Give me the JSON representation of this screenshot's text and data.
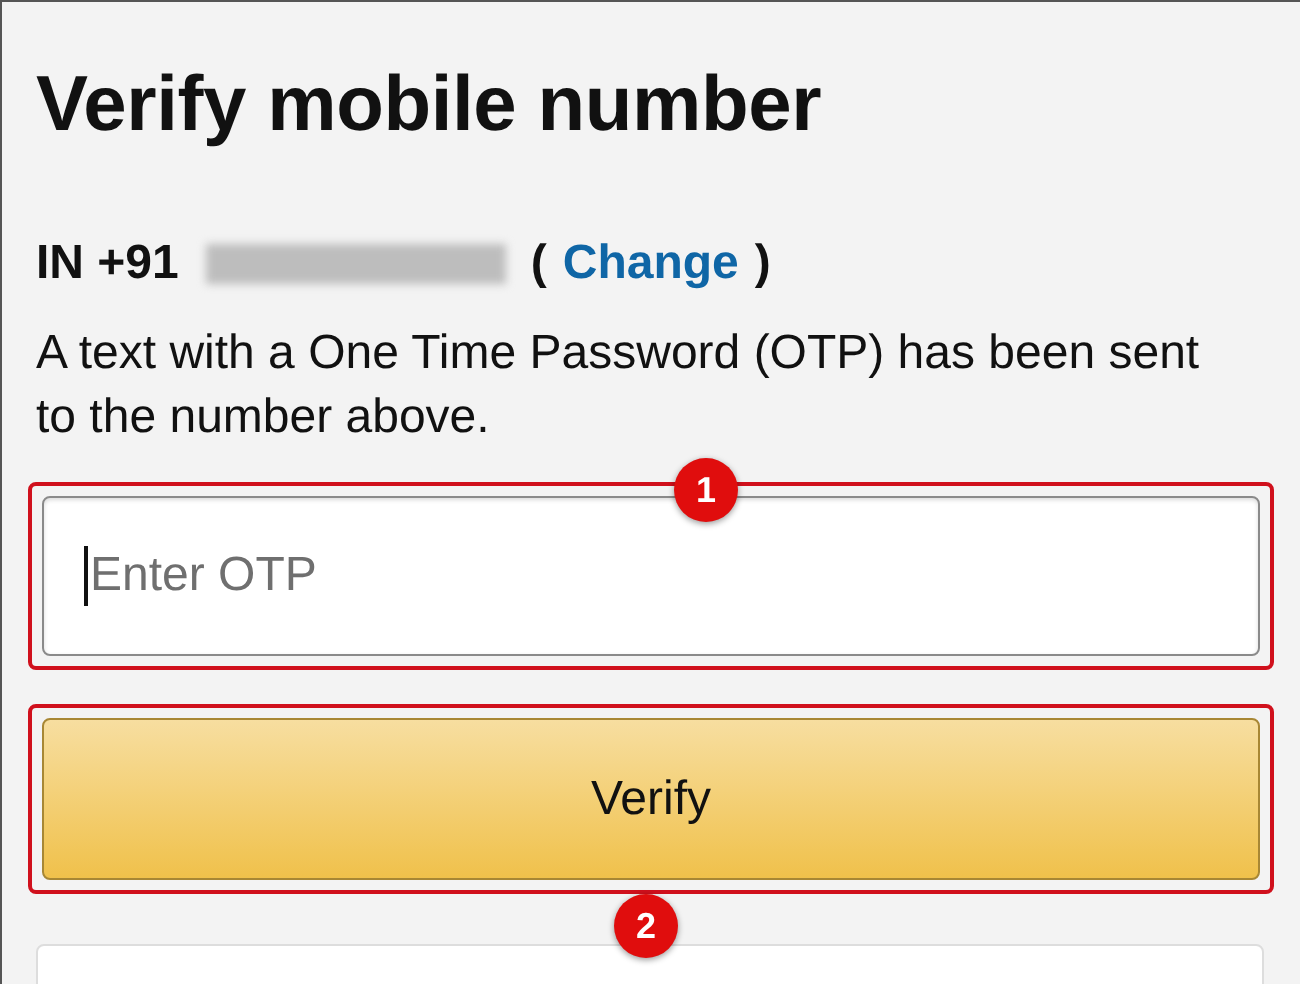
{
  "title": "Verify mobile number",
  "phone": {
    "country_code": "IN +91",
    "open_paren": "(",
    "change_link": "Change",
    "close_paren": ")"
  },
  "message": "A text with a One Time Password (OTP) has been sent to the number above.",
  "otp_field": {
    "placeholder": "Enter OTP",
    "highlighted": true
  },
  "verify_button": {
    "label": "Verify",
    "highlighted": true
  },
  "callouts": [
    "1",
    "2"
  ]
}
